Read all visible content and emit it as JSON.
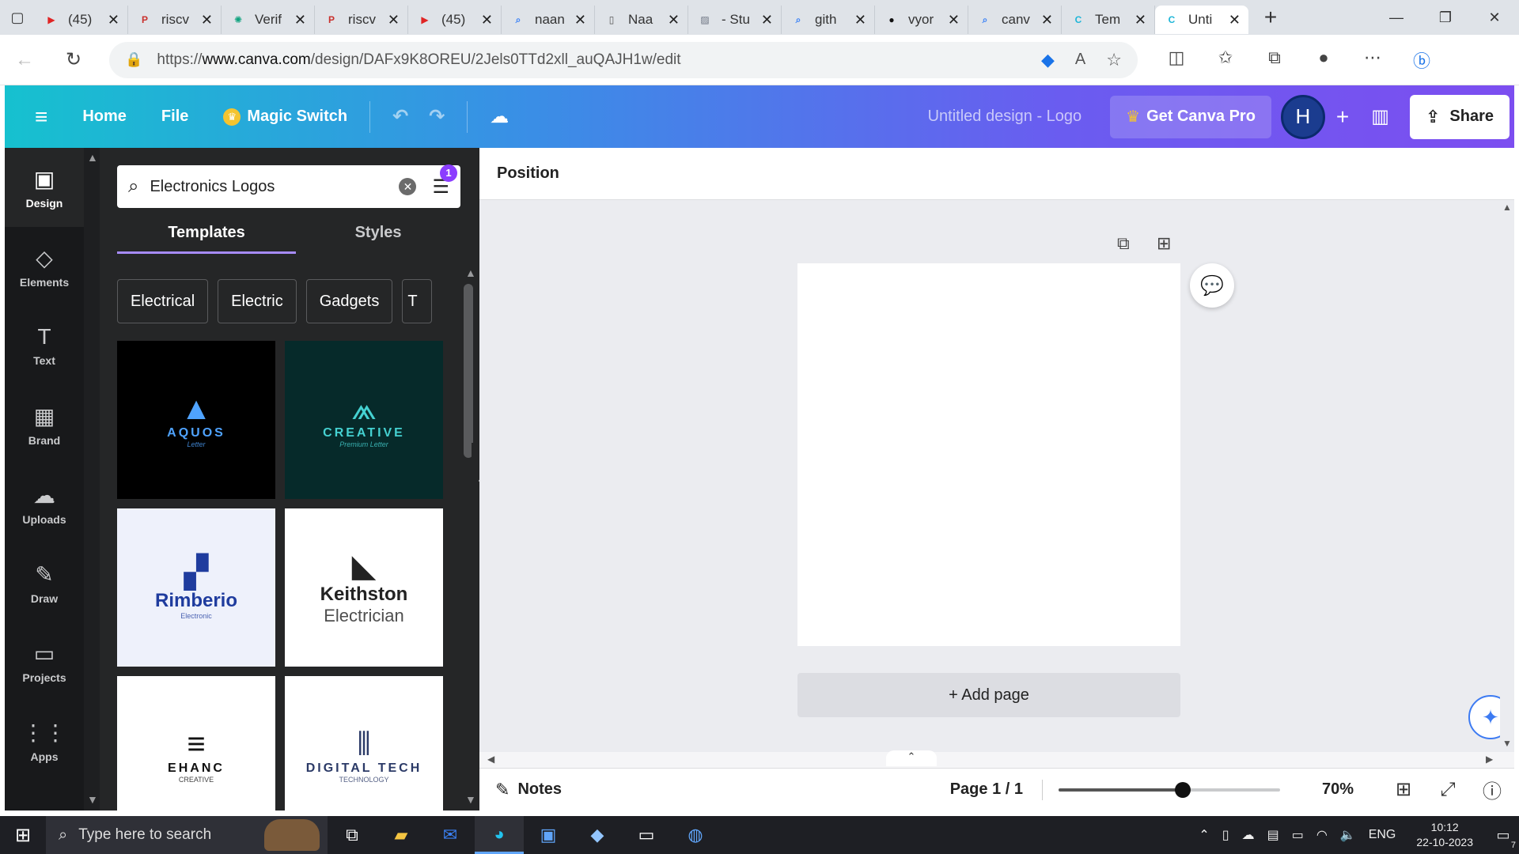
{
  "browser": {
    "tabs": [
      {
        "title": "(45)",
        "favicon": "youtube-icon",
        "color": "#e02424"
      },
      {
        "title": "riscv",
        "favicon": "pdf-icon",
        "color": "#c9302c"
      },
      {
        "title": "Verif",
        "favicon": "chatgpt-icon",
        "color": "#10a37f"
      },
      {
        "title": "riscv",
        "favicon": "pdf-icon",
        "color": "#c9302c"
      },
      {
        "title": "(45)",
        "favicon": "youtube-icon",
        "color": "#e02424"
      },
      {
        "title": "naan",
        "favicon": "search-icon",
        "color": "#3b82f6"
      },
      {
        "title": "Naa",
        "favicon": "document-icon",
        "color": "#555555"
      },
      {
        "title": "- Stu",
        "favicon": "image-icon",
        "color": "#6b7280"
      },
      {
        "title": "gith",
        "favicon": "search-icon",
        "color": "#3b82f6"
      },
      {
        "title": "vyor",
        "favicon": "github-icon",
        "color": "#111111"
      },
      {
        "title": "canv",
        "favicon": "search-icon",
        "color": "#3b82f6"
      },
      {
        "title": "Tem",
        "favicon": "canva-icon",
        "color": "#1fb6d8"
      },
      {
        "title": "Unti",
        "favicon": "canva-icon",
        "color": "#1fb6d8"
      }
    ],
    "url_prefix": "https://",
    "url_host": "www.canva.com",
    "url_path": "/design/DAFx9K8OREU/2Jels0TTd2xll_auQAJH1w/edit"
  },
  "header": {
    "home": "Home",
    "file": "File",
    "magic_switch": "Magic Switch",
    "design_title": "Untitled design - Logo",
    "get_pro": "Get Canva Pro",
    "avatar_initial": "H",
    "share": "Share"
  },
  "rail": {
    "items": [
      {
        "label": "Design",
        "icon": "layout-icon"
      },
      {
        "label": "Elements",
        "icon": "shapes-icon"
      },
      {
        "label": "Text",
        "icon": "text-icon"
      },
      {
        "label": "Brand",
        "icon": "brand-icon"
      },
      {
        "label": "Uploads",
        "icon": "cloud-upload-icon"
      },
      {
        "label": "Draw",
        "icon": "pen-icon"
      },
      {
        "label": "Projects",
        "icon": "folder-icon"
      },
      {
        "label": "Apps",
        "icon": "grid-icon"
      }
    ]
  },
  "panel": {
    "search_value": "Electronics Logos",
    "filter_badge": "1",
    "tabs": [
      "Templates",
      "Styles"
    ],
    "chips": [
      "Electrical",
      "Electric",
      "Gadgets",
      "T"
    ],
    "templates": [
      {
        "name": "AQUOS",
        "subtitle": "Letter",
        "bg": "#000000",
        "fg": "#4fa3ff"
      },
      {
        "name": "CREATIVE",
        "subtitle": "Premium Letter",
        "bg": "#062a2a",
        "fg": "#45d1d1"
      },
      {
        "name": "Rimberio",
        "subtitle": "Electronic",
        "bg": "#eef1fb",
        "fg": "#1f3c9e"
      },
      {
        "name": "Keithston",
        "subtitle": "Electrician",
        "bg": "#ffffff",
        "fg": "#222222"
      },
      {
        "name": "EHANC",
        "subtitle": "CREATIVE",
        "bg": "#ffffff",
        "fg": "#111111"
      },
      {
        "name": "DIGITAL TECH",
        "subtitle": "TECHNOLOGY",
        "bg": "#ffffff",
        "fg": "#2b3a67"
      }
    ]
  },
  "editor": {
    "context_label": "Position",
    "add_page": "+ Add page",
    "notes": "Notes",
    "page_count": "Page 1 / 1",
    "zoom_percent": 70,
    "zoom_label": "70%"
  },
  "taskbar": {
    "search_placeholder": "Type here to search",
    "language": "ENG",
    "time": "10:12",
    "date": "22-10-2023",
    "notification_count": "7"
  }
}
